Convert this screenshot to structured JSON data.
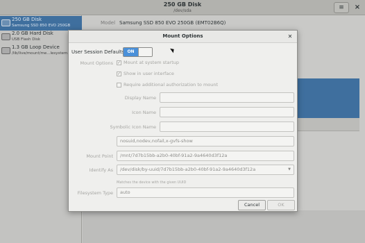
{
  "window": {
    "title": "250 GB Disk",
    "subtitle": "/dev/sda"
  },
  "sidebar": {
    "items": [
      {
        "name": "250 GB Disk",
        "detail": "Samsung SSD 850 EVO 250GB"
      },
      {
        "name": "2.0 GB Hard Disk",
        "detail": "USB Flash Disk"
      },
      {
        "name": "1.3 GB Loop Device",
        "detail": "/lib/live/mount/me...lesystem.squ"
      }
    ]
  },
  "background": {
    "model_label": "Model",
    "model_value": "Samsung SSD 850 EVO 250GB (EMT02B6Q)"
  },
  "dialog": {
    "title": "Mount Options",
    "user_session_defaults_label": "User Session Defaults",
    "switch_state": "ON",
    "mount_options_label": "Mount Options",
    "checkboxes": [
      {
        "label": "Mount at system startup",
        "checked": true
      },
      {
        "label": "Show in user interface",
        "checked": true
      },
      {
        "label": "Require additional authorization to mount",
        "checked": false
      }
    ],
    "display_name_label": "Display Name",
    "display_name_value": "",
    "icon_name_label": "Icon Name",
    "icon_name_value": "",
    "symbolic_icon_name_label": "Symbolic Icon Name",
    "symbolic_icon_name_value": "",
    "options_value": "nosuid,nodev,nofail,x-gvfs-show",
    "mount_point_label": "Mount Point",
    "mount_point_value": "/mnt/7d7b15bb-a2b0-40bf-91a2-9a4640d3f12a",
    "identify_as_label": "Identify As",
    "identify_as_value": "/dev/disk/by-uuid/7d7b15bb-a2b0-40bf-91a2-9a4640d3f12a",
    "identify_hint": "Matches the device with the given UUID",
    "filesystem_type_label": "Filesystem Type",
    "filesystem_type_value": "auto",
    "cancel_label": "Cancel",
    "ok_label": "OK"
  },
  "colors": {
    "selection_blue": "#3f6f9e",
    "switch_blue": "#4a90d9"
  },
  "icons": [
    "menu-icon",
    "close-icon",
    "disk-icon",
    "checkbox-check-icon",
    "dropdown-arrow-icon"
  ]
}
